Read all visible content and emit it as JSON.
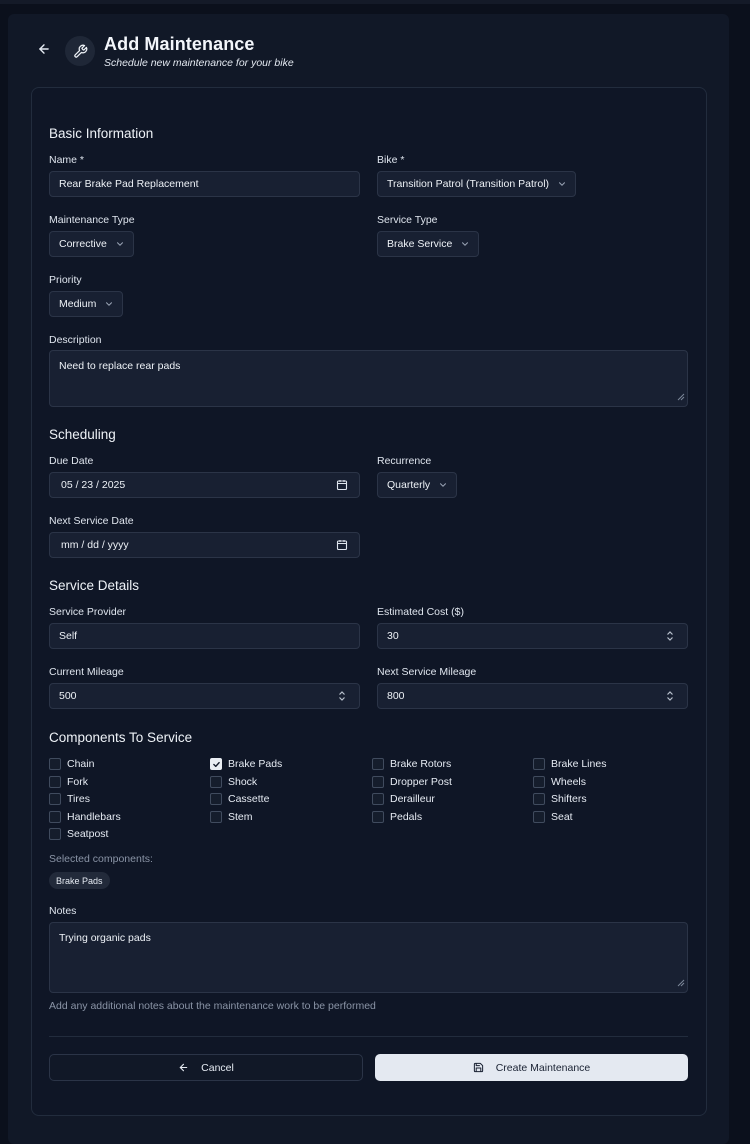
{
  "header": {
    "title": "Add Maintenance",
    "subtitle": "Schedule new maintenance for your bike"
  },
  "basic": {
    "section_title": "Basic Information",
    "name_label": "Name *",
    "name_value": "Rear Brake Pad Replacement",
    "bike_label": "Bike *",
    "bike_value": "Transition Patrol (Transition Patrol)",
    "maintenance_type_label": "Maintenance Type",
    "maintenance_type_value": "Corrective",
    "service_type_label": "Service Type",
    "service_type_value": "Brake Service",
    "priority_label": "Priority",
    "priority_value": "Medium",
    "description_label": "Description",
    "description_value": "Need to replace rear pads"
  },
  "scheduling": {
    "section_title": "Scheduling",
    "due_date_label": "Due Date",
    "due_date_value": "05 / 23 / 2025",
    "recurrence_label": "Recurrence",
    "recurrence_value": "Quarterly",
    "next_service_date_label": "Next Service Date",
    "next_service_date_value": "mm / dd / yyyy"
  },
  "service_details": {
    "section_title": "Service Details",
    "provider_label": "Service Provider",
    "provider_value": "Self",
    "cost_label": "Estimated Cost ($)",
    "cost_value": "30",
    "current_mileage_label": "Current Mileage",
    "current_mileage_value": "500",
    "next_mileage_label": "Next Service Mileage",
    "next_mileage_value": "800"
  },
  "components": {
    "section_title": "Components To Service",
    "items": [
      {
        "label": "Chain",
        "checked": false
      },
      {
        "label": "Brake Pads",
        "checked": true
      },
      {
        "label": "Brake Rotors",
        "checked": false
      },
      {
        "label": "Brake Lines",
        "checked": false
      },
      {
        "label": "Fork",
        "checked": false
      },
      {
        "label": "Shock",
        "checked": false
      },
      {
        "label": "Dropper Post",
        "checked": false
      },
      {
        "label": "Wheels",
        "checked": false
      },
      {
        "label": "Tires",
        "checked": false
      },
      {
        "label": "Cassette",
        "checked": false
      },
      {
        "label": "Derailleur",
        "checked": false
      },
      {
        "label": "Shifters",
        "checked": false
      },
      {
        "label": "Handlebars",
        "checked": false
      },
      {
        "label": "Stem",
        "checked": false
      },
      {
        "label": "Pedals",
        "checked": false
      },
      {
        "label": "Seat",
        "checked": false
      },
      {
        "label": "Seatpost",
        "checked": false
      }
    ],
    "selected_label": "Selected components:",
    "selected_chips": [
      "Brake Pads"
    ]
  },
  "notes": {
    "label": "Notes",
    "value": "Trying organic pads",
    "hint": "Add any additional notes about the maintenance work to be performed"
  },
  "actions": {
    "cancel_label": "Cancel",
    "create_label": "Create Maintenance"
  },
  "icons": {
    "back": "arrow-left-icon",
    "header": "wrench-icon",
    "calendar": "calendar-icon",
    "save": "save-icon"
  },
  "colors": {
    "background": "#0b101c",
    "panel": "#111827",
    "field": "#182032",
    "primary_button": "#e4e9f1"
  }
}
